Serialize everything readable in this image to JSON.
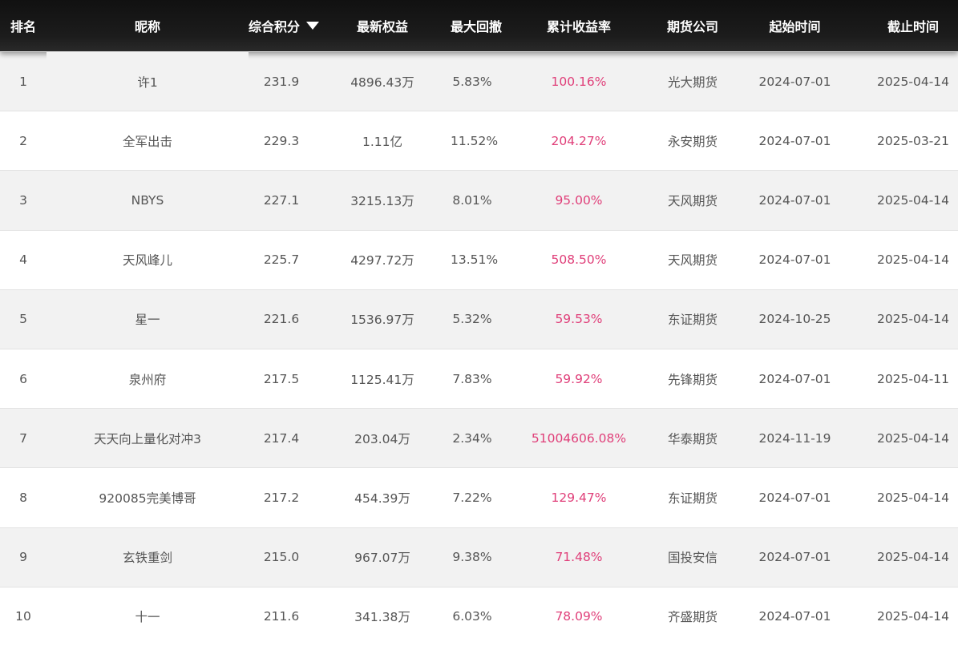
{
  "table": {
    "headers": {
      "rank": "排名",
      "nickname": "昵称",
      "score": "综合积分",
      "equity": "最新权益",
      "max_drawdown": "最大回撤",
      "cumulative_return": "累计收益率",
      "company": "期货公司",
      "start_date": "起始时间",
      "end_date": "截止时间"
    },
    "sort_icon": "triangle-down-icon",
    "accent_color": "#e0407a",
    "rows": [
      {
        "rank": "1",
        "nickname": "许1",
        "score": "231.9",
        "equity": "4896.43万",
        "max_drawdown": "5.83%",
        "cumulative_return": "100.16%",
        "company": "光大期货",
        "start_date": "2024-07-01",
        "end_date": "2025-04-14"
      },
      {
        "rank": "2",
        "nickname": "全军出击",
        "score": "229.3",
        "equity": "1.11亿",
        "max_drawdown": "11.52%",
        "cumulative_return": "204.27%",
        "company": "永安期货",
        "start_date": "2024-07-01",
        "end_date": "2025-03-21"
      },
      {
        "rank": "3",
        "nickname": "NBYS",
        "score": "227.1",
        "equity": "3215.13万",
        "max_drawdown": "8.01%",
        "cumulative_return": "95.00%",
        "company": "天风期货",
        "start_date": "2024-07-01",
        "end_date": "2025-04-14"
      },
      {
        "rank": "4",
        "nickname": "天风峰儿",
        "score": "225.7",
        "equity": "4297.72万",
        "max_drawdown": "13.51%",
        "cumulative_return": "508.50%",
        "company": "天风期货",
        "start_date": "2024-07-01",
        "end_date": "2025-04-14"
      },
      {
        "rank": "5",
        "nickname": "星一",
        "score": "221.6",
        "equity": "1536.97万",
        "max_drawdown": "5.32%",
        "cumulative_return": "59.53%",
        "company": "东证期货",
        "start_date": "2024-10-25",
        "end_date": "2025-04-14"
      },
      {
        "rank": "6",
        "nickname": "泉州府",
        "score": "217.5",
        "equity": "1125.41万",
        "max_drawdown": "7.83%",
        "cumulative_return": "59.92%",
        "company": "先锋期货",
        "start_date": "2024-07-01",
        "end_date": "2025-04-11"
      },
      {
        "rank": "7",
        "nickname": "天天向上量化对冲3",
        "score": "217.4",
        "equity": "203.04万",
        "max_drawdown": "2.34%",
        "cumulative_return": "51004606.08%",
        "company": "华泰期货",
        "start_date": "2024-11-19",
        "end_date": "2025-04-14"
      },
      {
        "rank": "8",
        "nickname": "920085完美博哥",
        "score": "217.2",
        "equity": "454.39万",
        "max_drawdown": "7.22%",
        "cumulative_return": "129.47%",
        "company": "东证期货",
        "start_date": "2024-07-01",
        "end_date": "2025-04-14"
      },
      {
        "rank": "9",
        "nickname": "玄铁重剑",
        "score": "215.0",
        "equity": "967.07万",
        "max_drawdown": "9.38%",
        "cumulative_return": "71.48%",
        "company": "国投安信",
        "start_date": "2024-07-01",
        "end_date": "2025-04-14"
      },
      {
        "rank": "10",
        "nickname": "十一",
        "score": "211.6",
        "equity": "341.38万",
        "max_drawdown": "6.03%",
        "cumulative_return": "78.09%",
        "company": "齐盛期货",
        "start_date": "2024-07-01",
        "end_date": "2025-04-14"
      }
    ]
  }
}
